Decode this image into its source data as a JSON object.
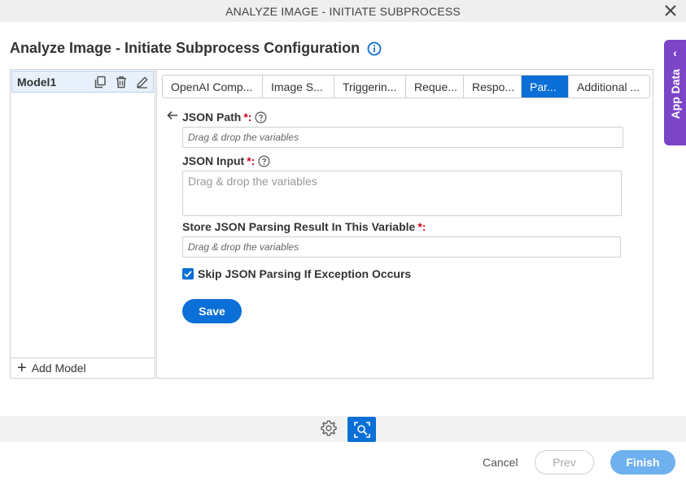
{
  "window": {
    "title": "ANALYZE IMAGE - INITIATE SUBPROCESS"
  },
  "page": {
    "heading": "Analyze Image - Initiate Subprocess Configuration"
  },
  "app_data": {
    "label": "App Data",
    "chevron": "‹"
  },
  "models": {
    "items": [
      {
        "label": "Model1"
      }
    ],
    "add_label": "Add Model"
  },
  "tabs": [
    {
      "label": "OpenAI Comp..."
    },
    {
      "label": "Image S..."
    },
    {
      "label": "Triggerin..."
    },
    {
      "label": "Reque..."
    },
    {
      "label": "Respo..."
    },
    {
      "label": "Par...",
      "active": true
    },
    {
      "label": "Additional ..."
    }
  ],
  "form": {
    "json_path": {
      "label": "JSON Path",
      "required": "*:",
      "placeholder": "Drag & drop the variables"
    },
    "json_input": {
      "label": "JSON Input",
      "required": "*:",
      "placeholder": "Drag & drop the variables"
    },
    "store_result": {
      "label": "Store JSON Parsing Result In This Variable",
      "required": "*:",
      "placeholder": "Drag & drop the variables"
    },
    "skip_checkbox": {
      "label": "Skip JSON Parsing If Exception Occurs",
      "checked": true
    },
    "save_label": "Save"
  },
  "footer": {
    "cancel_label": "Cancel",
    "prev_label": "Prev",
    "finish_label": "Finish"
  },
  "colors": {
    "accent": "#0a6fd6",
    "app_data": "#7c45c8",
    "required": "#d0021b",
    "finish_disabled": "#6fb0ee"
  }
}
